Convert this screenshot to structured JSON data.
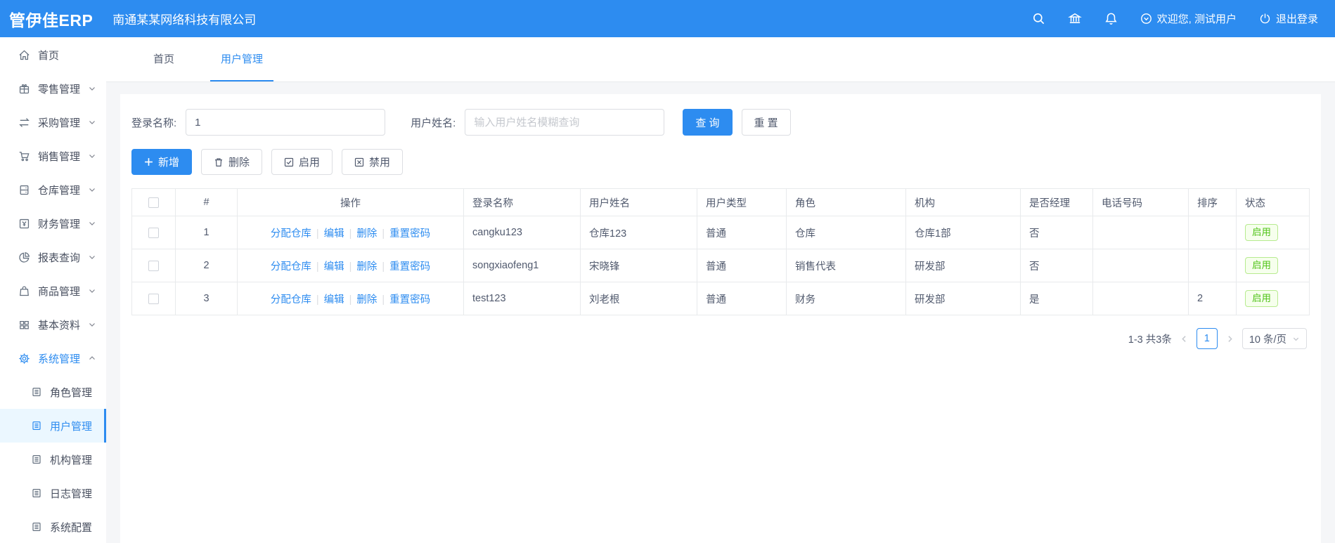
{
  "header": {
    "logo": "管伊佳ERP",
    "company": "南通某某网络科技有限公司",
    "welcome": "欢迎您, 测试用户",
    "logout": "退出登录",
    "icons": [
      "search-icon",
      "bank-icon",
      "bell-icon",
      "user-status-icon",
      "logout-icon"
    ]
  },
  "sidebar": {
    "items": [
      {
        "label": "首页",
        "icon": "home-icon"
      },
      {
        "label": "零售管理",
        "icon": "retail-icon",
        "arrow": "down"
      },
      {
        "label": "采购管理",
        "icon": "purchase-icon",
        "arrow": "down"
      },
      {
        "label": "销售管理",
        "icon": "sales-icon",
        "arrow": "down"
      },
      {
        "label": "仓库管理",
        "icon": "warehouse-icon",
        "arrow": "down"
      },
      {
        "label": "财务管理",
        "icon": "finance-icon",
        "arrow": "down"
      },
      {
        "label": "报表查询",
        "icon": "report-icon",
        "arrow": "down"
      },
      {
        "label": "商品管理",
        "icon": "goods-icon",
        "arrow": "down"
      },
      {
        "label": "基本资料",
        "icon": "basic-data-icon",
        "arrow": "down"
      },
      {
        "label": "系统管理",
        "icon": "system-icon",
        "arrow": "up",
        "active": true
      }
    ],
    "submenu": [
      {
        "label": "角色管理",
        "icon": "doc-icon"
      },
      {
        "label": "用户管理",
        "icon": "doc-icon",
        "active": true
      },
      {
        "label": "机构管理",
        "icon": "doc-icon"
      },
      {
        "label": "日志管理",
        "icon": "doc-icon"
      },
      {
        "label": "系统配置",
        "icon": "doc-icon"
      }
    ]
  },
  "tabs": [
    {
      "label": "首页",
      "active": false
    },
    {
      "label": "用户管理",
      "active": true
    }
  ],
  "search": {
    "login_label": "登录名称:",
    "login_value": "1",
    "name_label": "用户姓名:",
    "name_placeholder": "输入用户姓名模糊查询",
    "search_button": "查 询",
    "reset_button": "重 置"
  },
  "toolbar": {
    "add": "新增",
    "delete": "删除",
    "enable": "启用",
    "disable": "禁用"
  },
  "table": {
    "columns": [
      "",
      "#",
      "操作",
      "登录名称",
      "用户姓名",
      "用户类型",
      "角色",
      "机构",
      "是否经理",
      "电话号码",
      "排序",
      "状态"
    ],
    "action_links": [
      "分配仓库",
      "编辑",
      "删除",
      "重置密码"
    ],
    "rows": [
      {
        "index": "1",
        "login": "cangku123",
        "name": "仓库123",
        "type": "普通",
        "role": "仓库",
        "org": "仓库1部",
        "manager": "否",
        "phone": "",
        "sort": "",
        "status": "启用"
      },
      {
        "index": "2",
        "login": "songxiaofeng1",
        "name": "宋晓锋",
        "type": "普通",
        "role": "销售代表",
        "org": "研发部",
        "manager": "否",
        "phone": "",
        "sort": "",
        "status": "启用"
      },
      {
        "index": "3",
        "login": "test123",
        "name": "刘老根",
        "type": "普通",
        "role": "财务",
        "org": "研发部",
        "manager": "是",
        "phone": "",
        "sort": "2",
        "status": "启用"
      }
    ]
  },
  "pagination": {
    "total": "1-3 共3条",
    "current_page": "1",
    "page_size": "10 条/页"
  },
  "colors": {
    "primary": "#2d8cf0",
    "success_text": "#52c41a",
    "success_bg": "#f6ffed",
    "success_border": "#b7eb8f"
  }
}
